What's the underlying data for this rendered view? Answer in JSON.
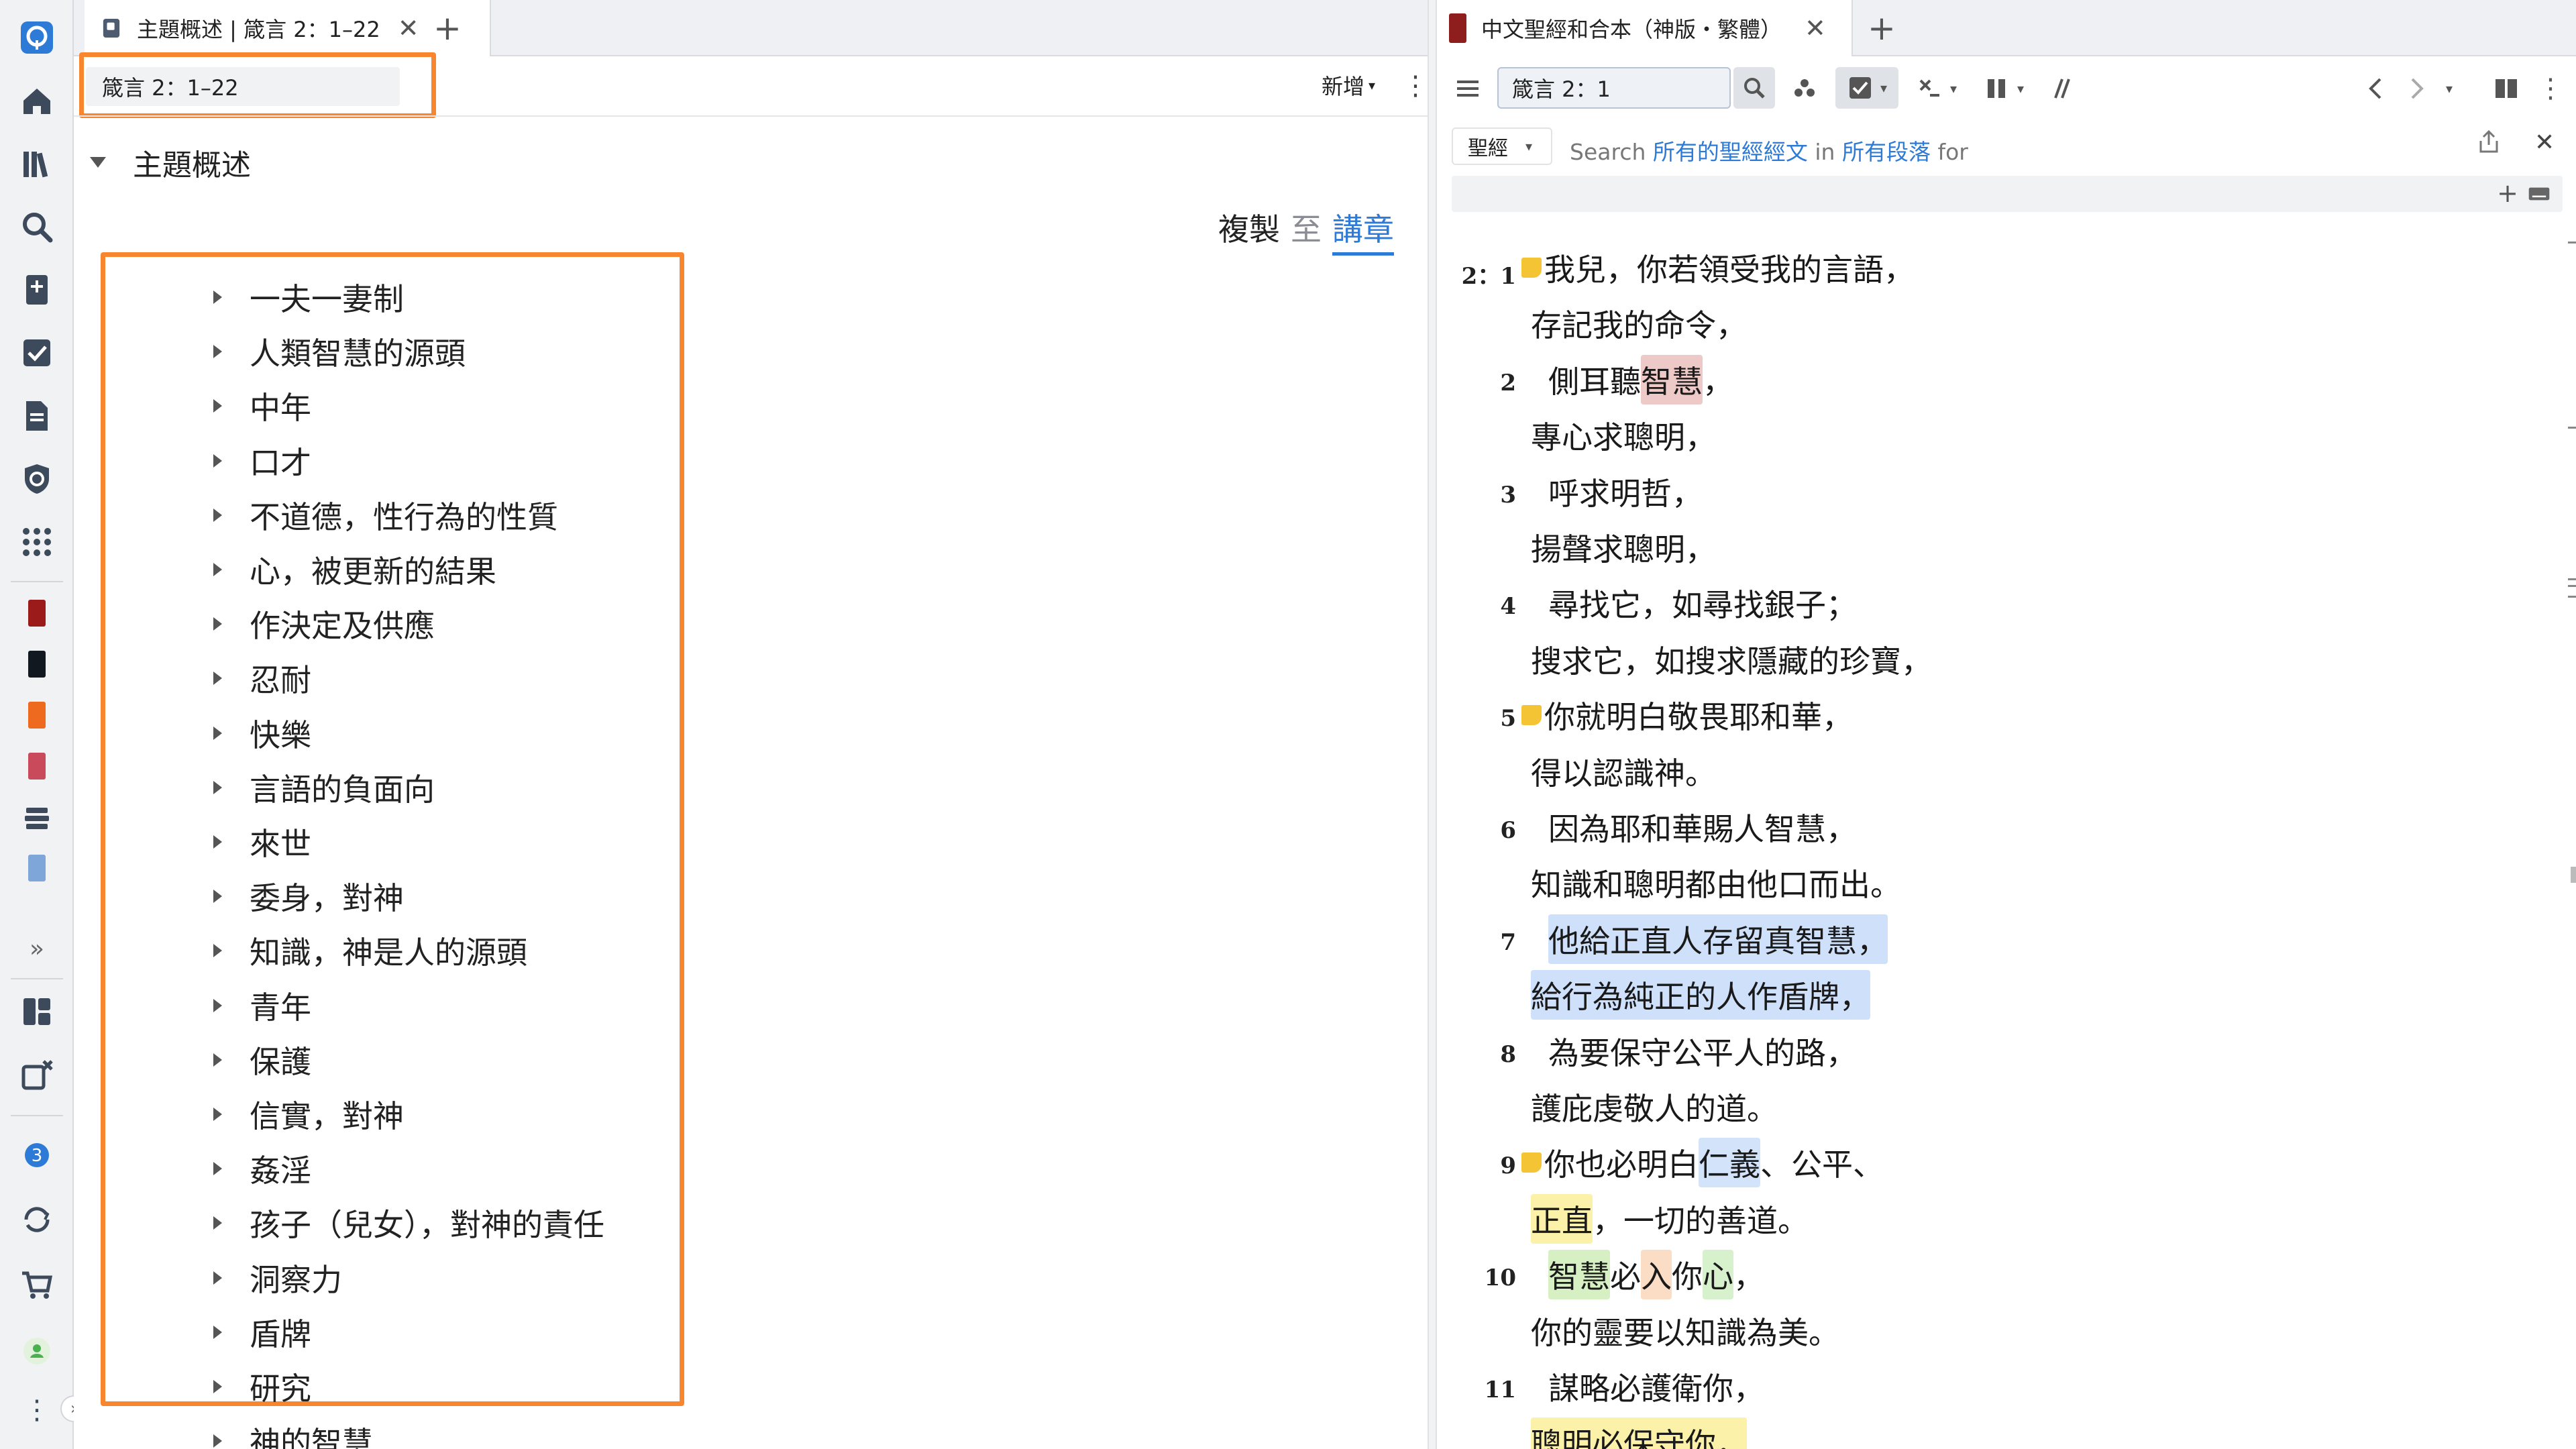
{
  "left_panel": {
    "tab": {
      "title": "主題概述 | 箴言 2：1–22",
      "close": "✕",
      "add": "+"
    },
    "reference": "箴言 2：1–22",
    "new_button": "新增",
    "section_title": "主題概述",
    "copy_label": "複製",
    "to_label": "至",
    "sermon_link": "講章",
    "topics": [
      "一夫一妻制",
      "人類智慧的源頭",
      "中年",
      "口才",
      "不道德，性行為的性質",
      "心，被更新的結果",
      "作決定及供應",
      "忍耐",
      "快樂",
      "言語的負面向",
      "來世",
      "委身，對神",
      "知識，神是人的源頭",
      "青年",
      "保護",
      "信實，對神",
      "姦淫",
      "孩子（兒女），對神的責任",
      "洞察力",
      "盾牌",
      "研究",
      "神的智慧"
    ]
  },
  "right_panel": {
    "tab": {
      "title": "中文聖經和合本（神版・繁體）",
      "close": "✕",
      "add": "+"
    },
    "bible_reference": "箴言 2：1",
    "search": {
      "dropdown": "聖經",
      "prefix": "Search",
      "scope": "所有的聖經經文",
      "in": "in",
      "range": "所有段落",
      "for": "for"
    },
    "verses": [
      {
        "num": "2：1",
        "note": true,
        "segments": [
          {
            "t": "我兒，你若領受我的言語，"
          }
        ]
      },
      {
        "num": "",
        "indent": true,
        "segments": [
          {
            "t": "存記我的命令，"
          }
        ]
      },
      {
        "num": "2",
        "segments": [
          {
            "t": "側耳聽"
          },
          {
            "t": "智慧",
            "hl": "red"
          },
          {
            "t": "，"
          }
        ]
      },
      {
        "num": "",
        "indent": true,
        "segments": [
          {
            "t": "專心求聰明，"
          }
        ]
      },
      {
        "num": "3",
        "segments": [
          {
            "t": "呼求明哲，"
          }
        ]
      },
      {
        "num": "",
        "indent": true,
        "segments": [
          {
            "t": "揚聲求聰明，"
          }
        ]
      },
      {
        "num": "4",
        "segments": [
          {
            "t": "尋找它，如尋找銀子；"
          }
        ]
      },
      {
        "num": "",
        "indent": true,
        "segments": [
          {
            "t": "搜求它，如搜求隱藏的珍寶，"
          }
        ]
      },
      {
        "num": "5",
        "note": true,
        "segments": [
          {
            "t": "你就明白敬畏耶和華，"
          }
        ]
      },
      {
        "num": "",
        "indent": true,
        "segments": [
          {
            "t": "得以認識神。"
          }
        ]
      },
      {
        "num": "6",
        "segments": [
          {
            "t": "因為耶和華賜人智慧，"
          }
        ]
      },
      {
        "num": "",
        "indent": true,
        "segments": [
          {
            "t": "知識和聰明都由他口而出。"
          }
        ]
      },
      {
        "num": "7",
        "segments": [
          {
            "t": "他給正直人存留真智慧，",
            "hl": "blue"
          }
        ]
      },
      {
        "num": "",
        "indent": true,
        "segments": [
          {
            "t": "給行為純正的人作盾牌，",
            "hl": "blue"
          }
        ]
      },
      {
        "num": "8",
        "segments": [
          {
            "t": "為要保守公平人的路，"
          }
        ]
      },
      {
        "num": "",
        "indent": true,
        "segments": [
          {
            "t": "護庇虔敬人的道。"
          }
        ]
      },
      {
        "num": "9",
        "note": true,
        "segments": [
          {
            "t": "你也必明白"
          },
          {
            "t": "仁義",
            "hl": "lblue"
          },
          {
            "t": "、公平、"
          }
        ]
      },
      {
        "num": "",
        "indent": true,
        "segments": [
          {
            "t": "正直",
            "hl": "yellow"
          },
          {
            "t": "，一切的善道。"
          }
        ]
      },
      {
        "num": "10",
        "segments": [
          {
            "t": "智慧",
            "hl": "green"
          },
          {
            "t": "必"
          },
          {
            "t": "入",
            "hl": "orange"
          },
          {
            "t": "你"
          },
          {
            "t": "心",
            "hl": "lgreen"
          },
          {
            "t": "，"
          }
        ]
      },
      {
        "num": "",
        "indent": true,
        "segments": [
          {
            "t": "你的靈要以知識為美。"
          }
        ]
      },
      {
        "num": "11",
        "segments": [
          {
            "t": "謀略必護衛你，"
          }
        ]
      },
      {
        "num": "",
        "indent": true,
        "segments": [
          {
            "t": "聰明必保守你，",
            "hl": "yellow"
          }
        ]
      }
    ]
  },
  "sidebar": {
    "icons": [
      "logos-icon",
      "home-icon",
      "library-icon",
      "search-icon",
      "add-document-icon",
      "checklist-icon",
      "document-icon",
      "shield-icon",
      "apps-grid-icon",
      "book-red-icon",
      "book-black-icon",
      "book-orange-icon",
      "book-pink-icon",
      "layers-icon",
      "book-blue-icon",
      "expand-icon",
      "layout-icon",
      "close-panels-icon",
      "notification-icon",
      "sync-icon",
      "cart-icon",
      "user-icon",
      "more-icon"
    ],
    "notification_count": "3"
  }
}
